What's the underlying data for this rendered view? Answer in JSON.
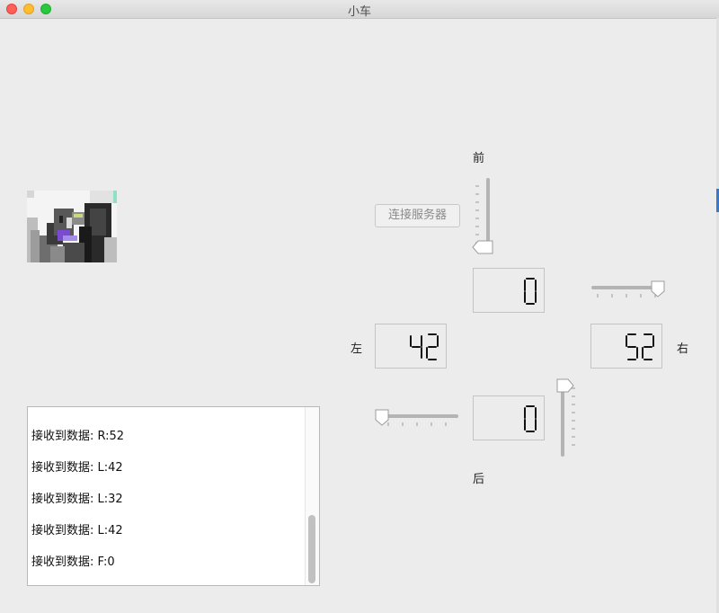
{
  "window": {
    "title": "小车"
  },
  "controls": {
    "connect_label": "连接服务器",
    "labels": {
      "forward": "前",
      "back": "后",
      "left": "左",
      "right": "右"
    },
    "sliders": {
      "forward": {
        "value": 0
      },
      "right": {
        "value": 0.93
      },
      "left": {
        "value": 0
      },
      "back": {
        "value": 1.0
      }
    },
    "displays": {
      "forward": "0",
      "left": "42",
      "right": "52",
      "back": "0"
    }
  },
  "log": {
    "lines": [
      "接收到数据: R:52",
      "接收到数据: L:42",
      "接收到数据: L:32",
      "接收到数据: L:42",
      "接收到数据: F:0"
    ]
  },
  "colors": {
    "accent": "#3a78c9",
    "lcd": "#111111"
  },
  "icons": [
    "close-icon",
    "minimize-icon",
    "zoom-icon"
  ]
}
